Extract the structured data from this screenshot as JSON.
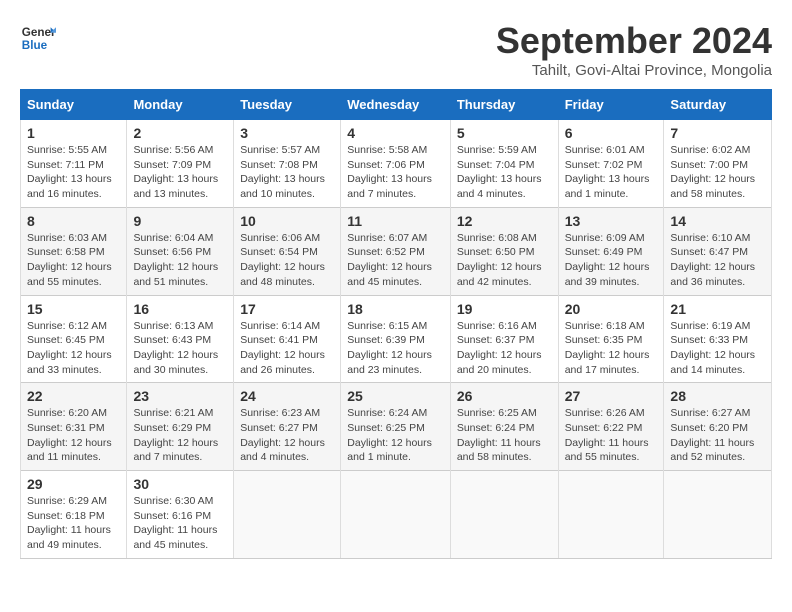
{
  "header": {
    "logo_line1": "General",
    "logo_line2": "Blue",
    "month_title": "September 2024",
    "subtitle": "Tahilt, Govi-Altai Province, Mongolia"
  },
  "weekdays": [
    "Sunday",
    "Monday",
    "Tuesday",
    "Wednesday",
    "Thursday",
    "Friday",
    "Saturday"
  ],
  "weeks": [
    [
      {
        "day": "1",
        "info": "Sunrise: 5:55 AM\nSunset: 7:11 PM\nDaylight: 13 hours\nand 16 minutes."
      },
      {
        "day": "2",
        "info": "Sunrise: 5:56 AM\nSunset: 7:09 PM\nDaylight: 13 hours\nand 13 minutes."
      },
      {
        "day": "3",
        "info": "Sunrise: 5:57 AM\nSunset: 7:08 PM\nDaylight: 13 hours\nand 10 minutes."
      },
      {
        "day": "4",
        "info": "Sunrise: 5:58 AM\nSunset: 7:06 PM\nDaylight: 13 hours\nand 7 minutes."
      },
      {
        "day": "5",
        "info": "Sunrise: 5:59 AM\nSunset: 7:04 PM\nDaylight: 13 hours\nand 4 minutes."
      },
      {
        "day": "6",
        "info": "Sunrise: 6:01 AM\nSunset: 7:02 PM\nDaylight: 13 hours\nand 1 minute."
      },
      {
        "day": "7",
        "info": "Sunrise: 6:02 AM\nSunset: 7:00 PM\nDaylight: 12 hours\nand 58 minutes."
      }
    ],
    [
      {
        "day": "8",
        "info": "Sunrise: 6:03 AM\nSunset: 6:58 PM\nDaylight: 12 hours\nand 55 minutes."
      },
      {
        "day": "9",
        "info": "Sunrise: 6:04 AM\nSunset: 6:56 PM\nDaylight: 12 hours\nand 51 minutes."
      },
      {
        "day": "10",
        "info": "Sunrise: 6:06 AM\nSunset: 6:54 PM\nDaylight: 12 hours\nand 48 minutes."
      },
      {
        "day": "11",
        "info": "Sunrise: 6:07 AM\nSunset: 6:52 PM\nDaylight: 12 hours\nand 45 minutes."
      },
      {
        "day": "12",
        "info": "Sunrise: 6:08 AM\nSunset: 6:50 PM\nDaylight: 12 hours\nand 42 minutes."
      },
      {
        "day": "13",
        "info": "Sunrise: 6:09 AM\nSunset: 6:49 PM\nDaylight: 12 hours\nand 39 minutes."
      },
      {
        "day": "14",
        "info": "Sunrise: 6:10 AM\nSunset: 6:47 PM\nDaylight: 12 hours\nand 36 minutes."
      }
    ],
    [
      {
        "day": "15",
        "info": "Sunrise: 6:12 AM\nSunset: 6:45 PM\nDaylight: 12 hours\nand 33 minutes."
      },
      {
        "day": "16",
        "info": "Sunrise: 6:13 AM\nSunset: 6:43 PM\nDaylight: 12 hours\nand 30 minutes."
      },
      {
        "day": "17",
        "info": "Sunrise: 6:14 AM\nSunset: 6:41 PM\nDaylight: 12 hours\nand 26 minutes."
      },
      {
        "day": "18",
        "info": "Sunrise: 6:15 AM\nSunset: 6:39 PM\nDaylight: 12 hours\nand 23 minutes."
      },
      {
        "day": "19",
        "info": "Sunrise: 6:16 AM\nSunset: 6:37 PM\nDaylight: 12 hours\nand 20 minutes."
      },
      {
        "day": "20",
        "info": "Sunrise: 6:18 AM\nSunset: 6:35 PM\nDaylight: 12 hours\nand 17 minutes."
      },
      {
        "day": "21",
        "info": "Sunrise: 6:19 AM\nSunset: 6:33 PM\nDaylight: 12 hours\nand 14 minutes."
      }
    ],
    [
      {
        "day": "22",
        "info": "Sunrise: 6:20 AM\nSunset: 6:31 PM\nDaylight: 12 hours\nand 11 minutes."
      },
      {
        "day": "23",
        "info": "Sunrise: 6:21 AM\nSunset: 6:29 PM\nDaylight: 12 hours\nand 7 minutes."
      },
      {
        "day": "24",
        "info": "Sunrise: 6:23 AM\nSunset: 6:27 PM\nDaylight: 12 hours\nand 4 minutes."
      },
      {
        "day": "25",
        "info": "Sunrise: 6:24 AM\nSunset: 6:25 PM\nDaylight: 12 hours\nand 1 minute."
      },
      {
        "day": "26",
        "info": "Sunrise: 6:25 AM\nSunset: 6:24 PM\nDaylight: 11 hours\nand 58 minutes."
      },
      {
        "day": "27",
        "info": "Sunrise: 6:26 AM\nSunset: 6:22 PM\nDaylight: 11 hours\nand 55 minutes."
      },
      {
        "day": "28",
        "info": "Sunrise: 6:27 AM\nSunset: 6:20 PM\nDaylight: 11 hours\nand 52 minutes."
      }
    ],
    [
      {
        "day": "29",
        "info": "Sunrise: 6:29 AM\nSunset: 6:18 PM\nDaylight: 11 hours\nand 49 minutes."
      },
      {
        "day": "30",
        "info": "Sunrise: 6:30 AM\nSunset: 6:16 PM\nDaylight: 11 hours\nand 45 minutes."
      },
      {
        "day": "",
        "info": ""
      },
      {
        "day": "",
        "info": ""
      },
      {
        "day": "",
        "info": ""
      },
      {
        "day": "",
        "info": ""
      },
      {
        "day": "",
        "info": ""
      }
    ]
  ]
}
